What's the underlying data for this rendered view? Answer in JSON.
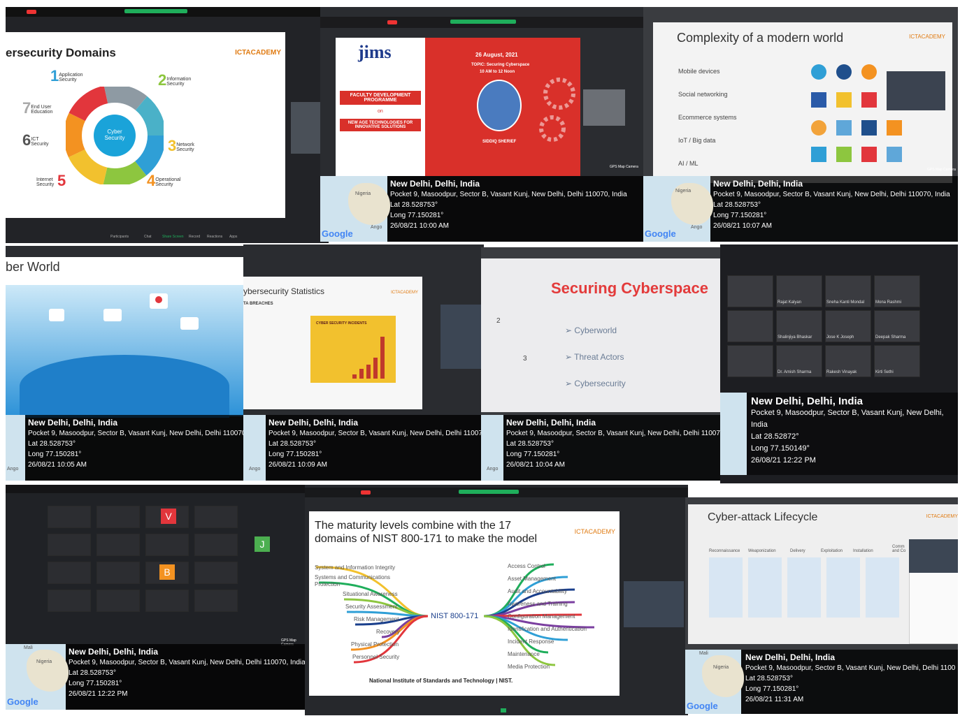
{
  "common": {
    "city": "New Delhi, Delhi, India",
    "address": "Pocket 9, Masoodpur, Sector B, Vasant Kunj, New Delhi, Delhi 110070, India",
    "lat": "Lat 28.528753°",
    "long": "Long 77.150281°",
    "google": "Google",
    "map_labels": [
      "Nigeria",
      "Ango",
      "Mali"
    ]
  },
  "tiles": {
    "t1": {
      "slide_title": "ersecurity Domains",
      "logo": "ICTACADEMY",
      "center": "Cyber Security",
      "domains": [
        {
          "num": "1",
          "label": "Application Security"
        },
        {
          "num": "2",
          "label": "Information Security"
        },
        {
          "num": "3",
          "label": "Network Security"
        },
        {
          "num": "4",
          "label": "Operational Security"
        },
        {
          "num": "5",
          "label": "Internet Security"
        },
        {
          "num": "6",
          "label": "ICT Security"
        },
        {
          "num": "7",
          "label": "End User Education"
        }
      ],
      "toolbar": [
        "Participants",
        "Chat",
        "Share Screen",
        "Record",
        "Reactions",
        "Apps"
      ]
    },
    "t2": {
      "brand": "jims",
      "date": "26 August, 2021",
      "topic": "TOPIC: Securing Cyberspace",
      "time": "10 AM to 12 Noon",
      "fdp": "FACULTY DEVELOPMENT PROGRAMME",
      "on": "on",
      "newage": "NEW AGE TECHNOLOGIES FOR INNOVATIVE SOLUTIONS",
      "speaker": "SIDDIQ SHERIEF",
      "gps_date": "26/08/21 10:00 AM",
      "gps_cam": "GPS Map Camera"
    },
    "t3": {
      "slide_title": "Complexity of a modern world",
      "logo": "ICTACADEMY",
      "bullets": [
        "Mobile devices",
        "Social networking",
        "Ecommerce systems",
        "IoT / Big data",
        "AI / ML"
      ],
      "gps_date": "26/08/21 10:07 AM",
      "gps_cam": "GPS Map Camera"
    },
    "t4": {
      "slide_title": "ber World",
      "gps_date": "26/08/21 10:05 AM"
    },
    "t5": {
      "slide_title": "ybersecurity Statistics",
      "logo": "ICTACADEMY",
      "breaches": "TA BREACHES",
      "incidents": "CYBER SECURITY INCIDENTS",
      "gps_date": "26/08/21 10:09 AM"
    },
    "t6": {
      "slide_title": "Securing Cyberspace",
      "items": [
        "Cyberworld",
        "Threat Actors",
        "Cybersecurity"
      ],
      "nums": [
        "2",
        "3"
      ],
      "gps_date": "26/08/21 10:04 AM"
    },
    "t7": {
      "city": "New Delhi, Delhi, India",
      "address_1": "Pocket 9, Masoodpur, Sector B, Vasant Kunj, New Delhi,",
      "address_2": "India",
      "lat": "Lat 28.52872°",
      "long": "Long 77.150149°",
      "gps_date": "26/08/21 12:22 PM",
      "names": [
        "Rajat Kalyan",
        "Sneha Kanti Mondal",
        "Mona Rashmi",
        "Shalinjiya Bhaskar",
        "Jose K Joseph",
        "Deepak Sharma",
        "Dr. Amish Sharma",
        "Rakesh Vinayak",
        "Kirti Sethi"
      ]
    },
    "t8": {
      "gps_date": "26/08/21 12:22 PM",
      "gps_cam": "GPS Map Camera",
      "letters": [
        "V",
        "B",
        "J"
      ]
    },
    "t9": {
      "slide_title_1": "The maturity levels combine with the 17",
      "slide_title_2": "domains of NIST 800-171 to make the model",
      "logo": "ICTACADEMY",
      "center": "NIST 800-171",
      "left_items": [
        "System and Information Integrity",
        "Systems and Communications Protection",
        "Situational Awareness",
        "Security Assessment",
        "Risk Management",
        "Recovery",
        "Physical Protection",
        "Personnel Security"
      ],
      "right_items": [
        "Access Control",
        "Asset Management",
        "Audit and Accountability",
        "Awareness and Training",
        "Configuration Management",
        "Identification and Authentication",
        "Incident Response",
        "Maintenance",
        "Media Protection"
      ],
      "footer": "National Institute of Standards and Technology | NIST."
    },
    "t10": {
      "slide_title": "Cyber-attack Lifecycle",
      "logo": "ICTACADEMY",
      "stages": [
        "Reconnaissance",
        "Weaponization",
        "Delivery",
        "Exploitation",
        "Installation",
        "Comm and Co"
      ],
      "gps_date": "26/08/21 11:31 AM"
    }
  },
  "colors": {
    "jims_red": "#d9302a",
    "zoom_green": "#1fae5b",
    "securing_red": "#e33b3b",
    "nist_blue": "#2a2a5a"
  }
}
